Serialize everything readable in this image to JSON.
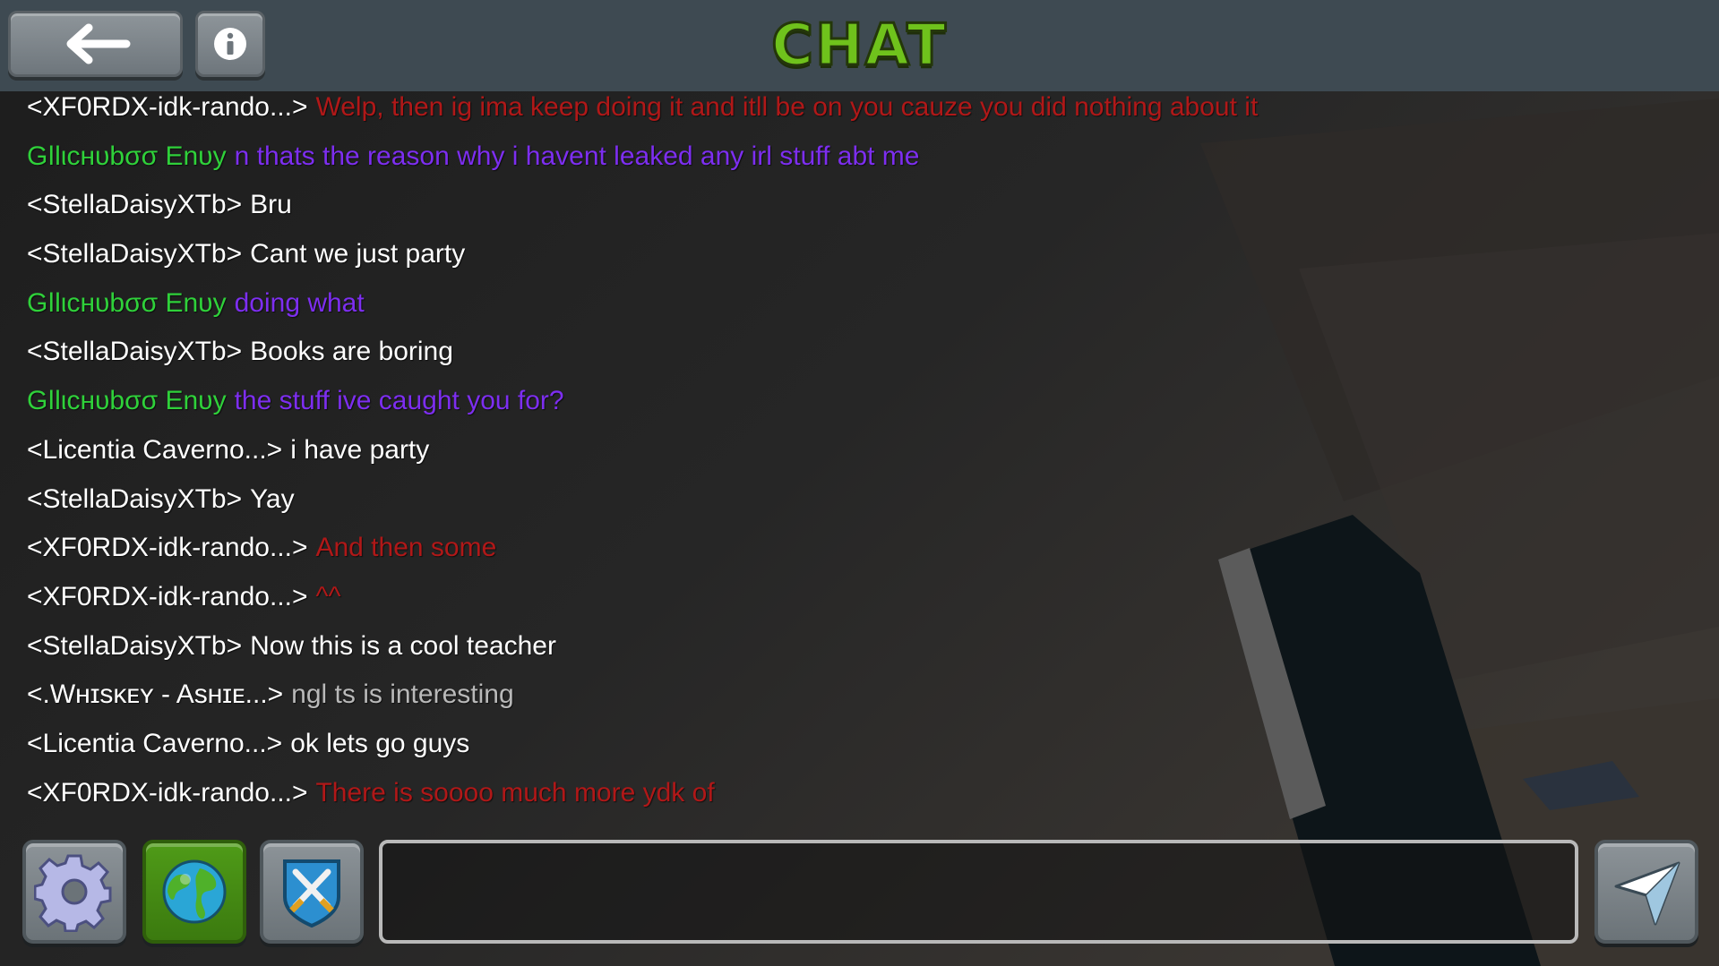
{
  "header": {
    "title": "CHAT",
    "back_icon": "back-arrow-icon",
    "info_icon": "info-icon"
  },
  "colors": {
    "title_green": "#6fc21c",
    "sender_default": "#ffffff",
    "glitch_name": "#2fd13a",
    "red_message": "#b01818",
    "purple_message": "#7d2ef0",
    "gray_message": "#b9b9b9"
  },
  "messages": [
    {
      "sender": "<XF0RDX-idk-rando...>",
      "text": "Welp, then ig ima keep doing it and itll be on you cauze you did nothing about it",
      "sender_color": "#ffffff",
      "text_color": "#b01818"
    },
    {
      "sender": "Gǀlιcнυbσσ Enυу",
      "text": "n thats the reason why i havent leaked any irl stuff abt me",
      "sender_color": "#2fd13a",
      "text_color": "#7d2ef0"
    },
    {
      "sender": "<StellaDaisyXTb>",
      "text": "Bru",
      "sender_color": "#ffffff",
      "text_color": "#ffffff"
    },
    {
      "sender": "<StellaDaisyXTb>",
      "text": "Cant we just party",
      "sender_color": "#ffffff",
      "text_color": "#ffffff"
    },
    {
      "sender": "Gǀlιcнυbσσ Enυу",
      "text": "doing what",
      "sender_color": "#2fd13a",
      "text_color": "#7d2ef0"
    },
    {
      "sender": "<StellaDaisyXTb>",
      "text": "Books are boring",
      "sender_color": "#ffffff",
      "text_color": "#ffffff"
    },
    {
      "sender": "Gǀlιcнυbσσ Enυу",
      "text": "the stuff ive caught you for?",
      "sender_color": "#2fd13a",
      "text_color": "#7d2ef0"
    },
    {
      "sender": "<Licentia Caverno...>",
      "text": "i have party",
      "sender_color": "#ffffff",
      "text_color": "#ffffff"
    },
    {
      "sender": "<StellaDaisyXTb>",
      "text": "Yay",
      "sender_color": "#ffffff",
      "text_color": "#ffffff"
    },
    {
      "sender": "<XF0RDX-idk-rando...>",
      "text": "And then some",
      "sender_color": "#ffffff",
      "text_color": "#b01818"
    },
    {
      "sender": "<XF0RDX-idk-rando...>",
      "text": "^^",
      "sender_color": "#ffffff",
      "text_color": "#b01818"
    },
    {
      "sender": "<StellaDaisyXTb>",
      "text": "Now this is a cool teacher",
      "sender_color": "#ffffff",
      "text_color": "#ffffff"
    },
    {
      "sender": "<.Wʜɪsᴋᴇʏ - Asʜɪᴇ...>",
      "text": "ngl ts is interesting",
      "sender_color": "#ffffff",
      "text_color": "#b9b9b9"
    },
    {
      "sender": "<Licentia Caverno...>",
      "text": "ok lets go guys",
      "sender_color": "#ffffff",
      "text_color": "#ffffff"
    },
    {
      "sender": "<XF0RDX-idk-rando...>",
      "text": "There is soooo much more ydk of",
      "sender_color": "#ffffff",
      "text_color": "#b01818"
    }
  ],
  "bottom_bar": {
    "settings_icon": "gear-icon",
    "global_icon": "globe-icon",
    "clan_icon": "crossed-swords-shield-icon",
    "send_icon": "paper-plane-icon",
    "input_value": "",
    "input_placeholder": ""
  }
}
